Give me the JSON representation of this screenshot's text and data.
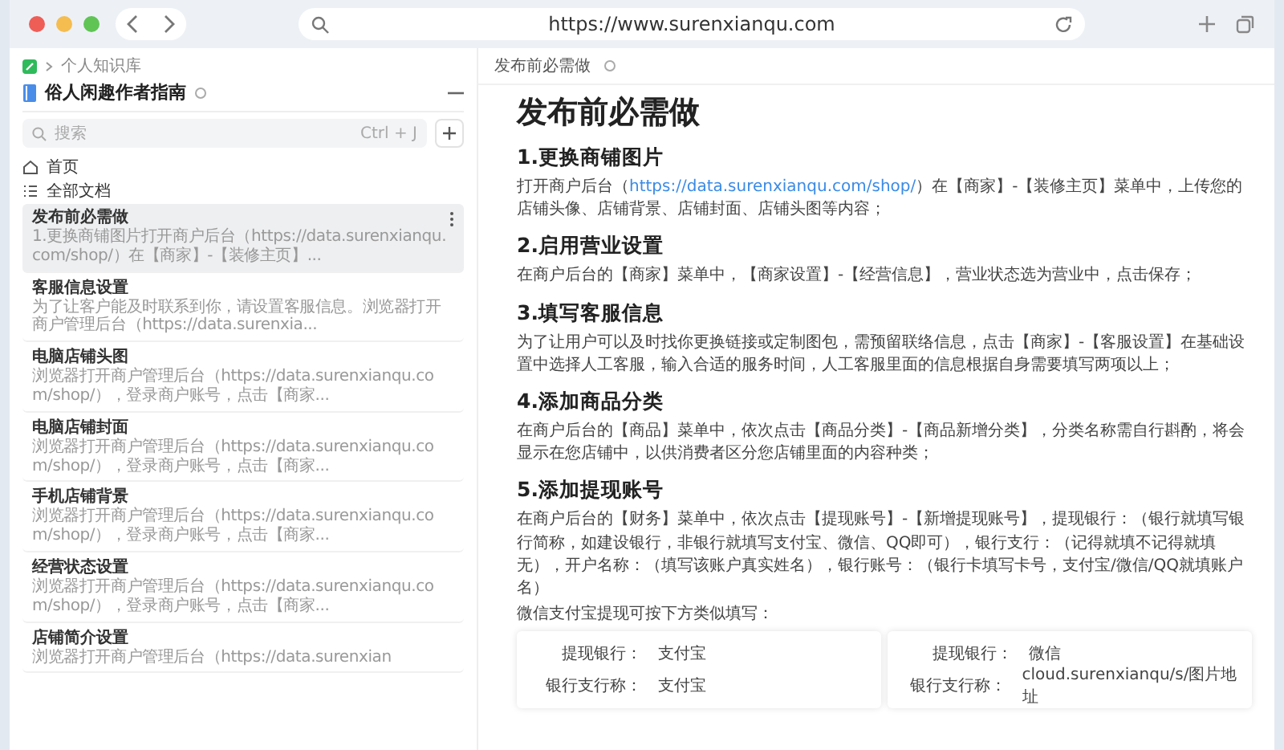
{
  "browser": {
    "url": "https://www.surenxianqu.com"
  },
  "sidebar": {
    "breadcrumb": "个人知识库",
    "title": "俗人闲趣作者指南",
    "search": {
      "placeholder": "搜索",
      "shortcut": "Ctrl + J"
    },
    "nav": [
      {
        "kind": "home",
        "label": "首页"
      },
      {
        "kind": "list",
        "label": "全部文档"
      }
    ],
    "docs": [
      {
        "title": "发布前必需做",
        "summary": "1.更换商铺图片打开商户后台（https://data.surenxianqu.com/shop/）在【商家】-【装修主页】...",
        "selected": true
      },
      {
        "title": "客服信息设置",
        "summary": "为了让客户能及时联系到你，请设置客服信息。浏览器打开商户管理后台（https://data.surenxia...",
        "selected": false
      },
      {
        "title": "电脑店铺头图",
        "summary": "浏览器打开商户管理后台（https://data.surenxianqu.com/shop/），登录商户账号，点击【商家...",
        "selected": false
      },
      {
        "title": "电脑店铺封面",
        "summary": "浏览器打开商户管理后台（https://data.surenxianqu.com/shop/），登录商户账号，点击【商家...",
        "selected": false
      },
      {
        "title": "手机店铺背景",
        "summary": "浏览器打开商户管理后台（https://data.surenxianqu.com/shop/），登录商户账号，点击【商家...",
        "selected": false
      },
      {
        "title": "经营状态设置",
        "summary": "浏览器打开商户管理后台（https://data.surenxianqu.com/shop/），登录商户账号，点击【商家...",
        "selected": false
      },
      {
        "title": "店铺简介设置",
        "summary": "浏览器打开商户管理后台（https://data.surenxian",
        "selected": false
      }
    ]
  },
  "document": {
    "tab_title": "发布前必需做",
    "title": "发布前必需做",
    "sections": [
      {
        "heading": "1.更换商铺图片",
        "paragraphs": [
          [
            {
              "kind": "text",
              "text": "打开商户后台（"
            },
            {
              "kind": "link",
              "text": "https://data.surenxianqu.com/shop/"
            },
            {
              "kind": "text",
              "text": "）在【商家】-【装修主页】菜单中，上传您的店铺头像、店铺背景、店铺封面、店铺头图等内容；"
            }
          ]
        ]
      },
      {
        "heading": "2.启用营业设置",
        "paragraphs": [
          [
            {
              "kind": "text",
              "text": "在商户后台的【商家】菜单中，【商家设置】-【经营信息】，营业状态选为营业中，点击保存；"
            }
          ]
        ]
      },
      {
        "heading": "3.填写客服信息",
        "paragraphs": [
          [
            {
              "kind": "text",
              "text": "为了让用户可以及时找你更换链接或定制图包，需预留联络信息，点击【商家】-【客服设置】在基础设置中选择人工客服，输入合适的服务时间，人工客服里面的信息根据自身需要填写两项以上；"
            }
          ]
        ]
      },
      {
        "heading": "4.添加商品分类",
        "paragraphs": [
          [
            {
              "kind": "text",
              "text": "在商户后台的【商品】菜单中，依次点击【商品分类】-【商品新增分类】，分类名称需自行斟酌，将会显示在您店铺中，以供消费者区分您店铺里面的内容种类；"
            }
          ]
        ]
      },
      {
        "heading": "5.添加提现账号",
        "paragraphs": [
          [
            {
              "kind": "text",
              "text": "在商户后台的【财务】菜单中，依次点击【提现账号】-【新增提现账号】，提现银行：（银行就填写银行简称，如建设银行，非银行就填写支付宝、微信、QQ即可），银行支行：（记得就填不记得就填无），开户名称：（填写该账户真实姓名），银行账号：（银行卡填写卡号，支付宝/微信/QQ就填账户名）"
            }
          ],
          [
            {
              "kind": "text",
              "text": "微信支付宝提现可按下方类似填写："
            }
          ]
        ]
      }
    ],
    "cards": [
      {
        "rows": [
          {
            "label": "提现银行：",
            "value": "支付宝"
          },
          {
            "label": "银行支行称：",
            "value": "支付宝"
          }
        ]
      },
      {
        "rows": [
          {
            "label": "提现银行：",
            "value": "微信"
          },
          {
            "label": "银行支行称：",
            "value": "cloud.surenxianqu/s/图片地址"
          }
        ]
      }
    ]
  }
}
